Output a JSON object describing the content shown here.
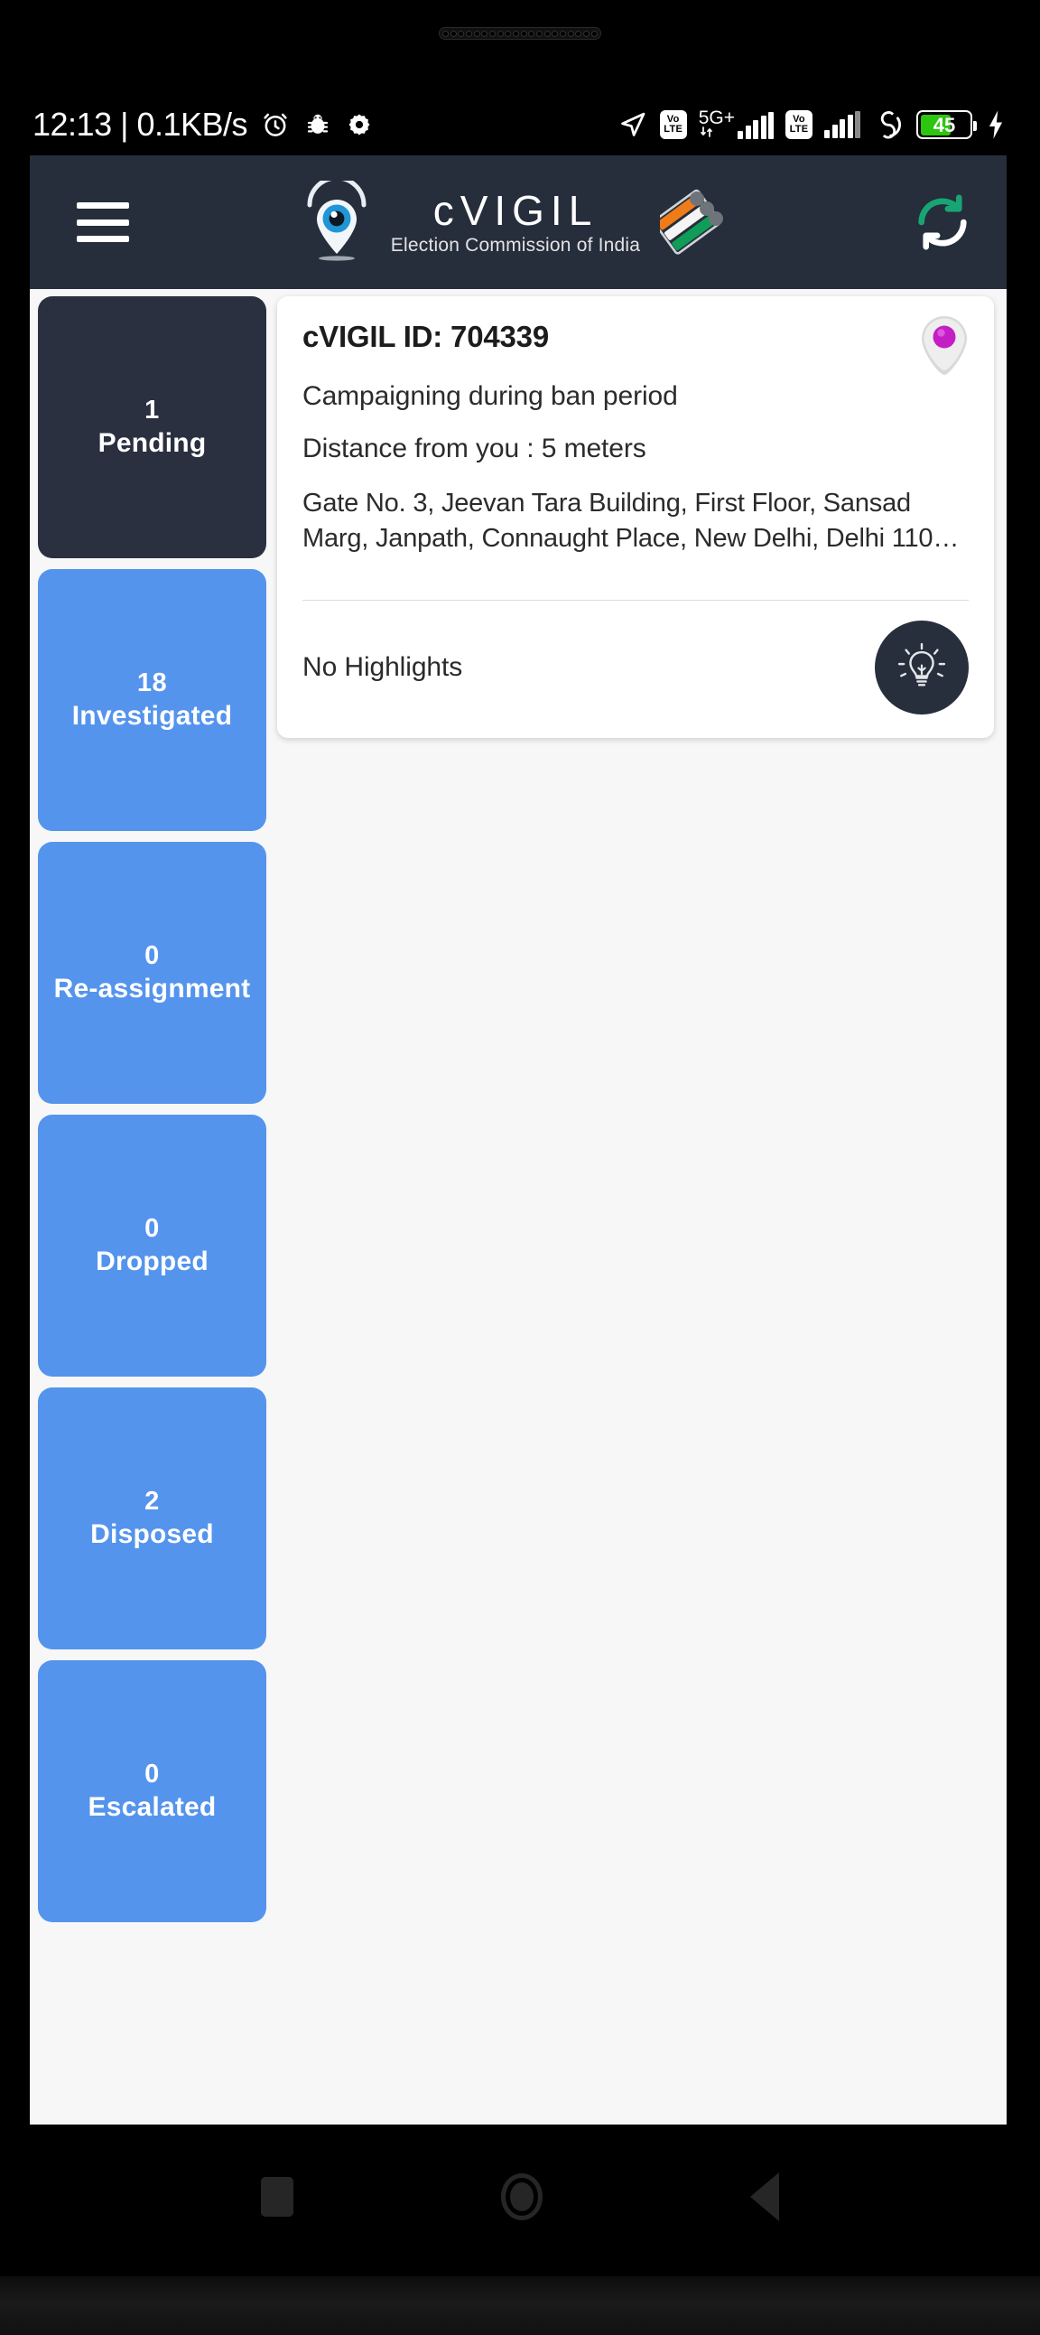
{
  "status_bar": {
    "clock": "12:13 | 0.1KB/s",
    "icons_left": [
      "alarm-icon",
      "debug-icon",
      "settings-icon"
    ],
    "icons_right": [
      "location-icon",
      "volte-icon",
      "network-5g-icon",
      "signal-icon",
      "volte-icon-2",
      "signal-icon-2",
      "do-not-disturb-icon",
      "battery-icon",
      "charging-icon"
    ],
    "network_label": "5G+",
    "volte_top": "Vo",
    "volte_bottom": "LTE",
    "battery_percent": "45"
  },
  "header": {
    "menu_icon": "hamburger-icon",
    "logo_icon": "cvigil-pin-eye-logo",
    "title": "cVIGIL",
    "subtitle": "Election Commission of India",
    "eci_icon": "election-commission-logo",
    "refresh_icon": "refresh-sync-icon"
  },
  "tiles": [
    {
      "count": "1",
      "label": "Pending",
      "active": true
    },
    {
      "count": "18",
      "label": "Investigated",
      "active": false
    },
    {
      "count": "0",
      "label": "Re-assignment",
      "active": false
    },
    {
      "count": "0",
      "label": "Dropped",
      "active": false
    },
    {
      "count": "2",
      "label": "Disposed",
      "active": false
    },
    {
      "count": "0",
      "label": "Escalated",
      "active": false
    }
  ],
  "card": {
    "id_label": "cVIGIL ID: 704339",
    "complaint_type": "Campaigning during ban period",
    "distance": "Distance from you : 5 meters",
    "address": "Gate No. 3, Jeevan Tara Building, First Floor, Sansad Marg, Janpath, Connaught Place, New Delhi, Delhi 110…",
    "pin_icon": "map-pin-magenta-icon",
    "highlights": "No Highlights",
    "bulb_icon": "lightbulb-icon"
  },
  "nav_bar": {
    "recents": "recents-icon",
    "home": "home-icon",
    "back": "back-icon"
  },
  "colors": {
    "accent_blue": "#5494ED",
    "dark_navy": "#262D3B",
    "page_bg": "#F7F7F7",
    "battery_green": "#2CC50F",
    "refresh_green": "#17A673",
    "pin_magenta": "#C41FC4"
  }
}
